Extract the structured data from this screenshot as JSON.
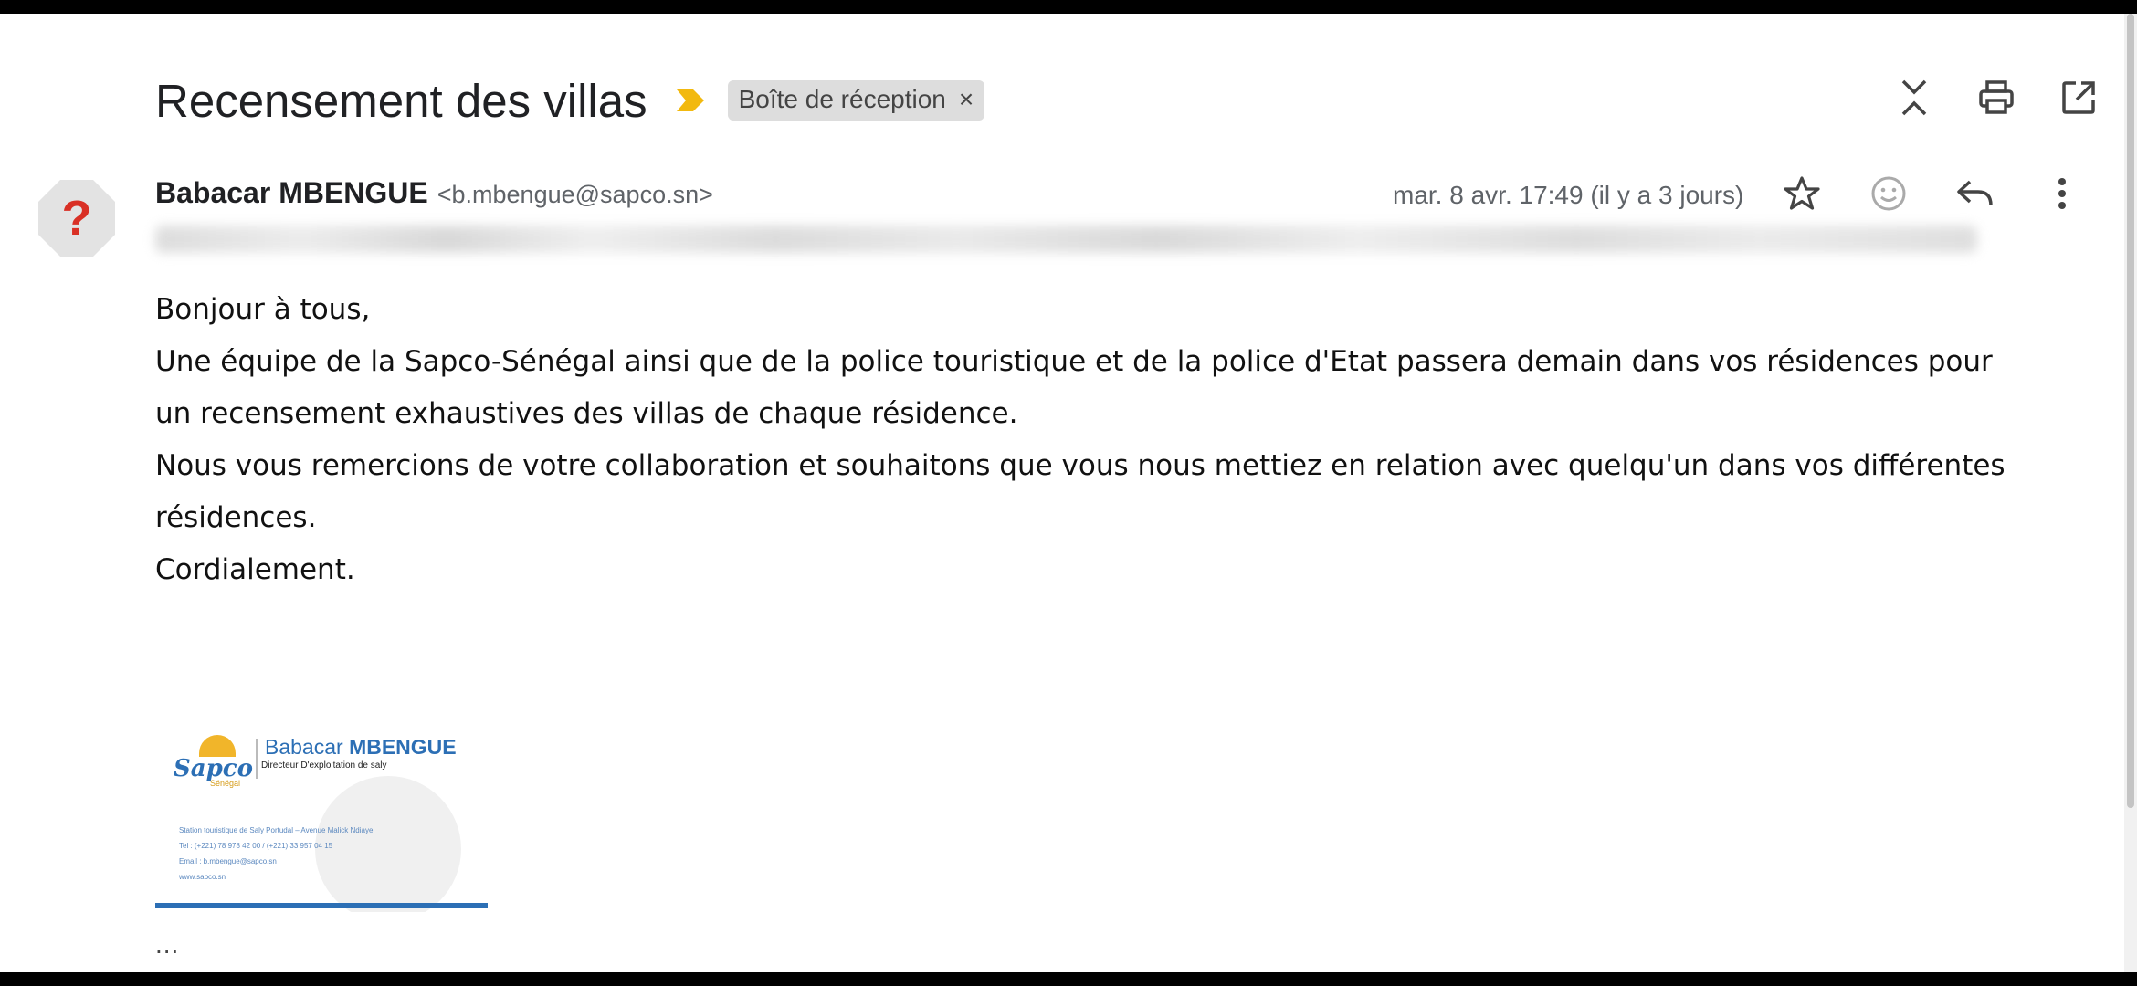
{
  "email": {
    "subject": "Recensement des villas",
    "label_chip": "Boîte de réception",
    "label_chip_close": "×",
    "sender_name": "Babacar MBENGUE",
    "sender_email": "<b.mbengue@sapco.sn>",
    "date": "mar. 8 avr. 17:49 (il y a 3 jours)",
    "body": [
      "Bonjour à tous,",
      "Une équipe de la Sapco-Sénégal ainsi que de la police touristique et de la police d'Etat passera demain dans vos résidences pour un recensement exhaustives des villas de chaque résidence.",
      "Nous vous remercions de votre collaboration et souhaitons que vous nous mettiez en relation avec quelqu'un dans vos différentes résidences.",
      "Cordialement."
    ],
    "trimmed_content": "..."
  },
  "signature": {
    "logo_text": "Sapco",
    "logo_subtext": "Sénégal",
    "first_name": "Babacar",
    "last_name": "MBENGUE",
    "title": "Directeur D'exploitation de saly",
    "address": "Station touristique de Saly Portudal – Avenue Malick Ndiaye",
    "phone": "Tel : (+221) 78 978 42 00 / (+221) 33 957 04 15",
    "email": "Email : b.mbengue@sapco.sn",
    "website": "www.sapco.sn"
  },
  "icons": {
    "importance": "importance-marker-icon",
    "collapse": "collapse-all-icon",
    "print": "print-icon",
    "open_new_window": "open-in-new-window-icon",
    "avatar": "unknown-sender-icon",
    "star": "star-icon",
    "emoji": "emoji-react-icon",
    "reply": "reply-icon",
    "more": "more-vert-icon"
  },
  "colors": {
    "importance_marker": "#f2b90f",
    "avatar_bg": "#e3e3e3",
    "avatar_mark": "#d93025",
    "brand_blue": "#2c6fb5",
    "brand_yellow": "#f1b52a"
  }
}
